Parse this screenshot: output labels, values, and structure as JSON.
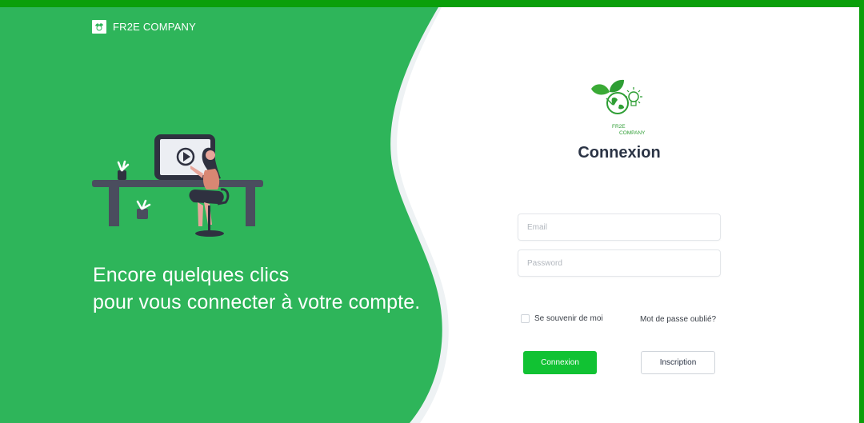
{
  "brand": {
    "name": "FR2E COMPANY",
    "logo_icon": "leaf-icon"
  },
  "hero": {
    "illustration": "woman-at-desk-video-illustration",
    "tagline_line1": "Encore quelques clics",
    "tagline_line2": "pour vous connecter à votre compte."
  },
  "form": {
    "logo": {
      "line1": "FR2E",
      "line2": "COMPANY"
    },
    "title": "Connexion",
    "email_placeholder": "Email",
    "email_value": "",
    "password_placeholder": "Password",
    "password_value": "",
    "remember_label": "Se souvenir de moi",
    "remember_checked": false,
    "forgot_label": "Mot de passe oublié?",
    "login_label": "Connexion",
    "signup_label": "Inscription"
  },
  "colors": {
    "panel_green": "#2eb55a",
    "border_green": "#0a9f0a",
    "button_green": "#11c233",
    "title_dark": "#2b3445"
  }
}
